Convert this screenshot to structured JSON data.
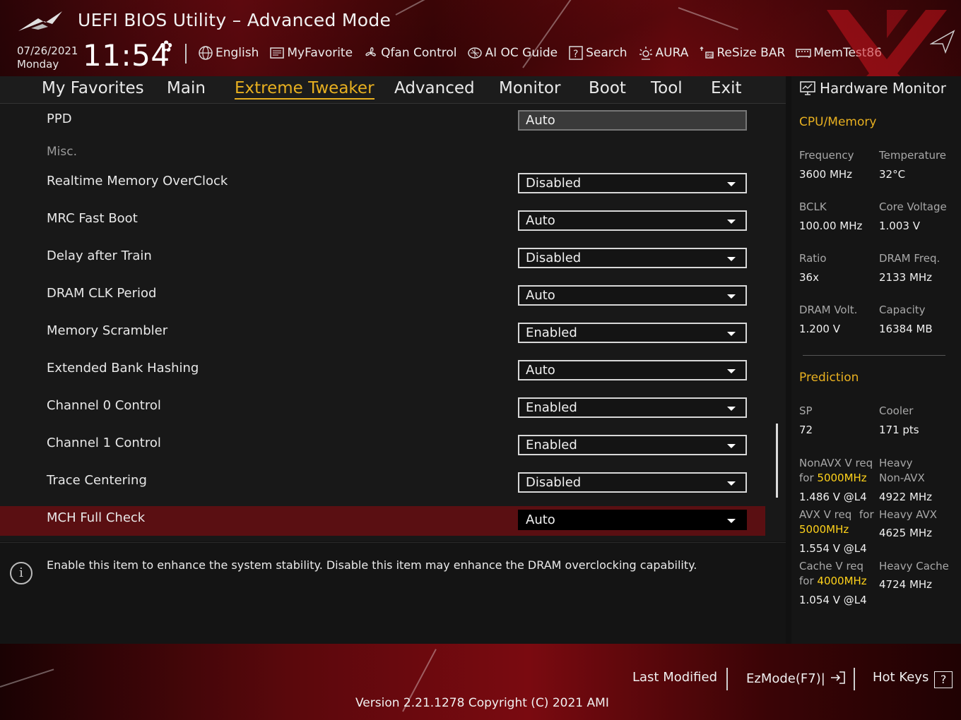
{
  "header": {
    "title": "UEFI BIOS Utility – Advanced Mode",
    "date": "07/26/2021",
    "day": "Monday",
    "time": "11:54",
    "toolbar": [
      {
        "label": "English",
        "icon": "globe-icon"
      },
      {
        "label": "MyFavorite",
        "icon": "favorite-icon"
      },
      {
        "label": "Qfan Control",
        "icon": "fan-icon"
      },
      {
        "label": "AI OC Guide",
        "icon": "ai-icon"
      },
      {
        "label": "Search",
        "icon": "search-icon"
      },
      {
        "label": "AURA",
        "icon": "aura-icon"
      },
      {
        "label": "ReSize BAR",
        "icon": "resize-bar-icon"
      },
      {
        "label": "MemTest86",
        "icon": "memtest-icon"
      }
    ]
  },
  "nav": {
    "tabs": [
      "My Favorites",
      "Main",
      "Extreme Tweaker",
      "Advanced",
      "Monitor",
      "Boot",
      "Tool",
      "Exit"
    ],
    "active": "Extreme Tweaker"
  },
  "settings": {
    "ppd": {
      "label": "PPD",
      "value": "Auto"
    },
    "misc_label": "Misc.",
    "rows": [
      {
        "label": "Realtime Memory OverClock",
        "value": "Disabled"
      },
      {
        "label": "MRC Fast Boot",
        "value": "Auto"
      },
      {
        "label": "Delay after Train",
        "value": "Disabled"
      },
      {
        "label": "DRAM CLK Period",
        "value": "Auto"
      },
      {
        "label": "Memory Scrambler",
        "value": "Enabled"
      },
      {
        "label": "Extended Bank Hashing",
        "value": "Auto"
      },
      {
        "label": "Channel 0 Control",
        "value": "Enabled"
      },
      {
        "label": "Channel 1 Control",
        "value": "Enabled"
      },
      {
        "label": "Trace Centering",
        "value": "Disabled"
      },
      {
        "label": "MCH Full Check",
        "value": "Auto"
      }
    ]
  },
  "help": {
    "text": "Enable this item to enhance the system stability. Disable this item may enhance the DRAM overclocking capability."
  },
  "hardware_monitor": {
    "title": "Hardware Monitor",
    "cpu_memory_title": "CPU/Memory",
    "cpu": [
      {
        "label": "Frequency",
        "value": "3600 MHz"
      },
      {
        "label": "Temperature",
        "value": "32°C"
      },
      {
        "label": "BCLK",
        "value": "100.00 MHz"
      },
      {
        "label": "Core Voltage",
        "value": "1.003 V"
      },
      {
        "label": "Ratio",
        "value": "36x"
      },
      {
        "label": "DRAM Freq.",
        "value": "2133 MHz"
      },
      {
        "label": "DRAM Volt.",
        "value": "1.200 V"
      },
      {
        "label": "Capacity",
        "value": "16384 MB"
      }
    ],
    "prediction_title": "Prediction",
    "sp_label": "SP",
    "sp_value": "72",
    "cooler_label": "Cooler",
    "cooler_value": "171 pts",
    "nonavx_label_1": "NonAVX V req",
    "nonavx_for": "for",
    "nonavx_freq": "5000MHz",
    "nonavx_value": "1.486 V @L4",
    "heavy_nonavx_label_1": "Heavy",
    "heavy_nonavx_label_2": "Non-AVX",
    "heavy_nonavx_value": "4922 MHz",
    "avx_label_1": "AVX V req",
    "avx_for": "for",
    "avx_freq": "5000MHz",
    "avx_value": "1.554 V @L4",
    "heavy_avx_label": "Heavy AVX",
    "heavy_avx_value": "4625 MHz",
    "cache_label_1": "Cache V req",
    "cache_for": "for",
    "cache_freq": "4000MHz",
    "cache_value": "1.054 V @L4",
    "heavy_cache_label": "Heavy Cache",
    "heavy_cache_value": "4724 MHz"
  },
  "footer": {
    "last_modified": "Last Modified",
    "ezmode": "EzMode(F7)|",
    "hotkeys": "Hot Keys",
    "hotkeys_icon_text": "?",
    "version": "Version 2.21.1278 Copyright (C) 2021 AMI"
  },
  "colors": {
    "accent": "#e8b020",
    "highlight_row": "#5a0f12",
    "brand_red": "#8a0c12",
    "prediction_yellow": "#ffd21a"
  }
}
